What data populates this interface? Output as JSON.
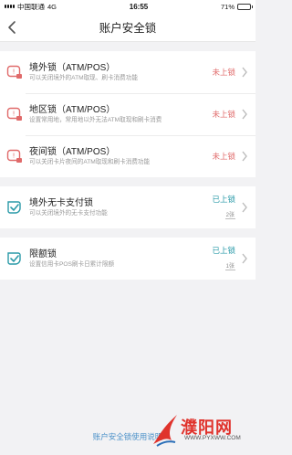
{
  "status_bar": {
    "carrier": "中国联通",
    "network": "4G",
    "time": "16:55",
    "battery": "71%",
    "battery_level": 0.71
  },
  "header": {
    "title": "账户安全锁"
  },
  "groups": [
    {
      "items": [
        {
          "name": "境外锁（ATM/POS）",
          "desc": "可以关闭境外的ATM取现、刷卡消费功能",
          "status": "未上锁",
          "state": "off",
          "icon": "lock-warning-icon"
        },
        {
          "name": "地区锁（ATM/POS）",
          "desc": "设置常用地，常用地以外无法ATM取现和刷卡消费",
          "status": "未上锁",
          "state": "off",
          "icon": "lock-warning-icon"
        },
        {
          "name": "夜间锁（ATM/POS）",
          "desc": "可以关闭卡片夜间的ATM取现和刷卡消费功能",
          "status": "未上锁",
          "state": "off",
          "icon": "lock-warning-icon"
        }
      ]
    },
    {
      "items": [
        {
          "name": "境外无卡支付锁",
          "desc": "可以关闭境外的无卡支付功能",
          "status": "已上锁",
          "count": "2张",
          "state": "on",
          "icon": "shield-check-icon"
        }
      ]
    },
    {
      "items": [
        {
          "name": "限额锁",
          "desc": "设置信用卡POS刷卡日累计限额",
          "status": "已上锁",
          "count": "1张",
          "state": "on",
          "icon": "shield-check-icon"
        }
      ]
    }
  ],
  "footer": {
    "link": "账户安全锁使用说明"
  },
  "watermark": {
    "name": "濮阳网",
    "url": "WWW.PYXWW.COM"
  },
  "colors": {
    "accent_on": "#2a9aa8",
    "accent_off": "#e06a6a",
    "link": "#4a90c8"
  }
}
